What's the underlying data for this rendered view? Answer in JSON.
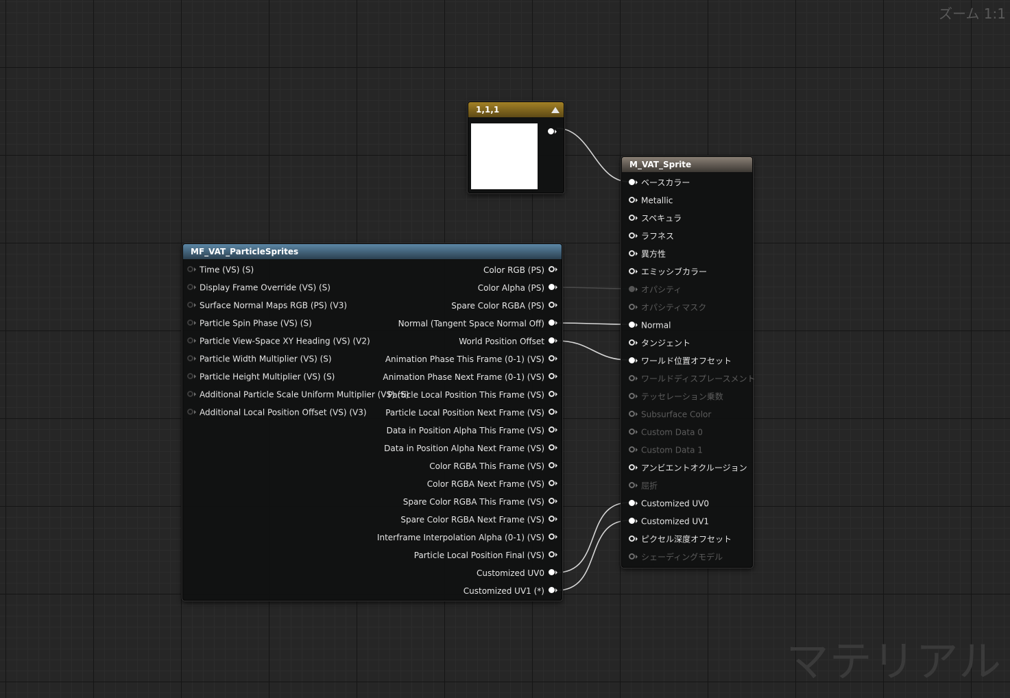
{
  "viewport": {
    "zoom_label": "ズーム 1:1",
    "watermark": "マテリアル"
  },
  "constant_node": {
    "title": "1,1,1",
    "header_color": "#a38126",
    "preview_color": "#ffffff",
    "collapse_icon": "triangle-up-icon"
  },
  "function_node": {
    "title": "MF_VAT_ParticleSprites",
    "header_color": "#4c7594",
    "inputs": [
      "Time (VS) (S)",
      "Display Frame Override (VS) (S)",
      "Surface Normal Maps RGB (PS) (V3)",
      "Particle Spin Phase (VS) (S)",
      "Particle View-Space XY Heading (VS) (V2)",
      "Particle Width Multiplier (VS) (S)",
      "Particle Height Multiplier (VS) (S)",
      "Additional Particle Scale Uniform Multiplier (VS) (S)",
      "Additional Local Position Offset (VS) (V3)"
    ],
    "outputs": [
      {
        "label": "Color RGB (PS)",
        "connected": false
      },
      {
        "label": "Color Alpha (PS)",
        "connected": true
      },
      {
        "label": "Spare Color RGBA (PS)",
        "connected": false
      },
      {
        "label": "Normal (Tangent Space Normal Off)",
        "connected": true
      },
      {
        "label": "World Position Offset",
        "connected": true
      },
      {
        "label": "Animation Phase This Frame (0-1) (VS)",
        "connected": false
      },
      {
        "label": "Animation Phase Next Frame (0-1) (VS)",
        "connected": false
      },
      {
        "label": "Particle Local Position This Frame (VS)",
        "connected": false
      },
      {
        "label": "Particle Local Position Next Frame (VS)",
        "connected": false
      },
      {
        "label": "Data in Position Alpha This Frame (VS)",
        "connected": false
      },
      {
        "label": "Data in Position Alpha Next Frame (VS)",
        "connected": false
      },
      {
        "label": "Color RGBA This Frame (VS)",
        "connected": false
      },
      {
        "label": "Color RGBA Next Frame (VS)",
        "connected": false
      },
      {
        "label": "Spare Color RGBA This Frame (VS)",
        "connected": false
      },
      {
        "label": "Spare Color RGBA Next Frame (VS)",
        "connected": false
      },
      {
        "label": "Interframe Interpolation Alpha (0-1) (VS)",
        "connected": false
      },
      {
        "label": "Particle Local Position Final (VS)",
        "connected": false
      },
      {
        "label": "Customized UV0",
        "connected": true
      },
      {
        "label": "Customized UV1 (*)",
        "connected": true
      }
    ]
  },
  "material_node": {
    "title": "M_VAT_Sprite",
    "header_color": "#6e665d",
    "inputs": [
      {
        "label": "ベースカラー",
        "enabled": true,
        "connected": true
      },
      {
        "label": "Metallic",
        "enabled": true,
        "connected": false
      },
      {
        "label": "スペキュラ",
        "enabled": true,
        "connected": false
      },
      {
        "label": "ラフネス",
        "enabled": true,
        "connected": false
      },
      {
        "label": "異方性",
        "enabled": true,
        "connected": false
      },
      {
        "label": "エミッシブカラー",
        "enabled": true,
        "connected": false
      },
      {
        "label": "オパシティ",
        "enabled": false,
        "connected": true
      },
      {
        "label": "オパシティマスク",
        "enabled": false,
        "connected": false
      },
      {
        "label": "Normal",
        "enabled": true,
        "connected": true
      },
      {
        "label": "タンジェント",
        "enabled": true,
        "connected": false
      },
      {
        "label": "ワールド位置オフセット",
        "enabled": true,
        "connected": true
      },
      {
        "label": "ワールドディスプレースメント",
        "enabled": false,
        "connected": false
      },
      {
        "label": "テッセレーション乗数",
        "enabled": false,
        "connected": false
      },
      {
        "label": "Subsurface Color",
        "enabled": false,
        "connected": false
      },
      {
        "label": "Custom Data 0",
        "enabled": false,
        "connected": false
      },
      {
        "label": "Custom Data 1",
        "enabled": false,
        "connected": false
      },
      {
        "label": "アンビエントオクルージョン",
        "enabled": true,
        "connected": false
      },
      {
        "label": "屈折",
        "enabled": false,
        "connected": false
      },
      {
        "label": "Customized UV0",
        "enabled": true,
        "connected": true
      },
      {
        "label": "Customized UV1",
        "enabled": true,
        "connected": true
      },
      {
        "label": "ピクセル深度オフセット",
        "enabled": true,
        "connected": false
      },
      {
        "label": "シェーディングモデル",
        "enabled": false,
        "connected": false
      }
    ]
  }
}
